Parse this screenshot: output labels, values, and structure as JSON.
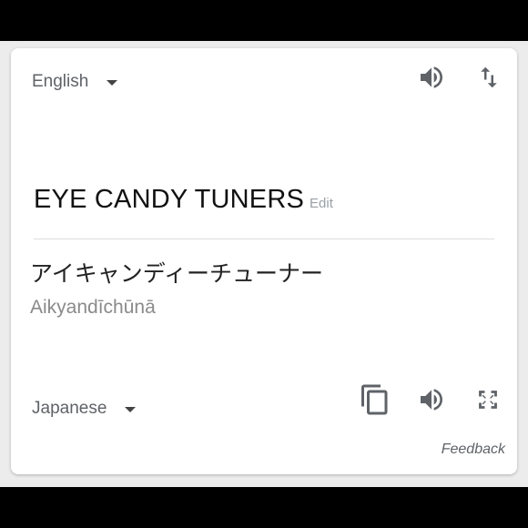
{
  "source": {
    "language": "English",
    "text": "EYE CANDY TUNERS",
    "edit_label": "Edit"
  },
  "target": {
    "language": "Japanese",
    "text": "アイキャンディーチューナー",
    "romanization": "Aikyandīchūnā"
  },
  "feedback_label": "Feedback",
  "icons": {
    "source_listen": "speaker-icon",
    "swap": "swap-languages-icon",
    "copy": "copy-icon",
    "target_listen": "speaker-icon",
    "fullscreen": "fullscreen-icon",
    "dropdown": "caret-down-icon"
  },
  "colors": {
    "icon": "#5f6368",
    "muted_text": "#9aa0a6",
    "divider": "#dadce0"
  }
}
